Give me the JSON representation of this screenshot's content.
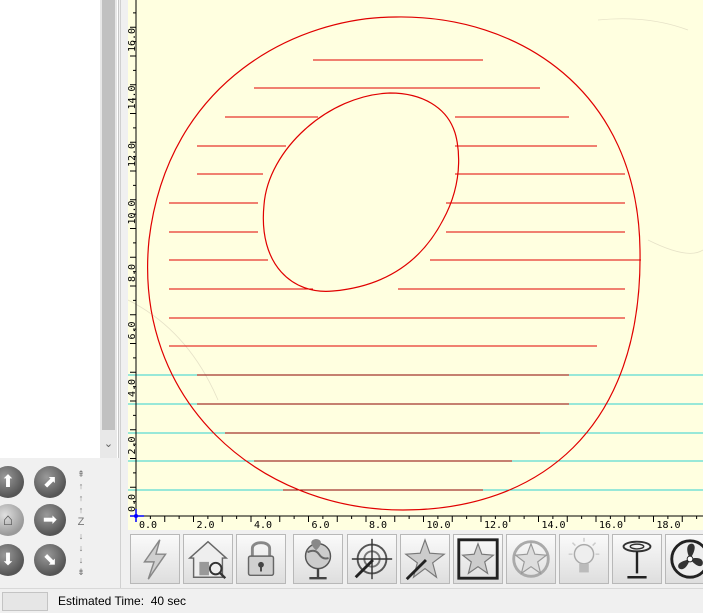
{
  "status": {
    "estimated_time_label": "Estimated Time:",
    "estimated_time_value": "40 sec"
  },
  "jog": {
    "z_label": "Z"
  },
  "icons": {
    "jog": [
      "arrow-up-icon",
      "arrow-up-right-icon",
      "home-icon",
      "arrow-right-icon",
      "arrow-down-icon",
      "arrow-down-right-icon"
    ],
    "toolbar": [
      "laser-fire-icon",
      "home-origin-icon",
      "lock-icon",
      "globe-icon",
      "target-crosshair-icon",
      "star-arrow-icon",
      "star-resize-icon",
      "star-rotate-icon",
      "lightbulb-icon",
      "air-assist-icon",
      "fan-icon"
    ]
  },
  "canvas": {
    "x_ticks": [
      "0.0",
      "2.0",
      "4.0",
      "6.0",
      "8.0",
      "10.0",
      "12.0",
      "14.0",
      "16.0",
      "18.0"
    ],
    "y_ticks": [
      "0.0",
      "2.0",
      "4.0",
      "6.0",
      "8.0",
      "10.0",
      "12.0",
      "14.0",
      "16.0"
    ],
    "colors": {
      "background": "#ffffe0",
      "cut": "#e00000",
      "scan_line": "#8b0000",
      "travel": "#30d0d0",
      "ruler": "#000000"
    }
  }
}
